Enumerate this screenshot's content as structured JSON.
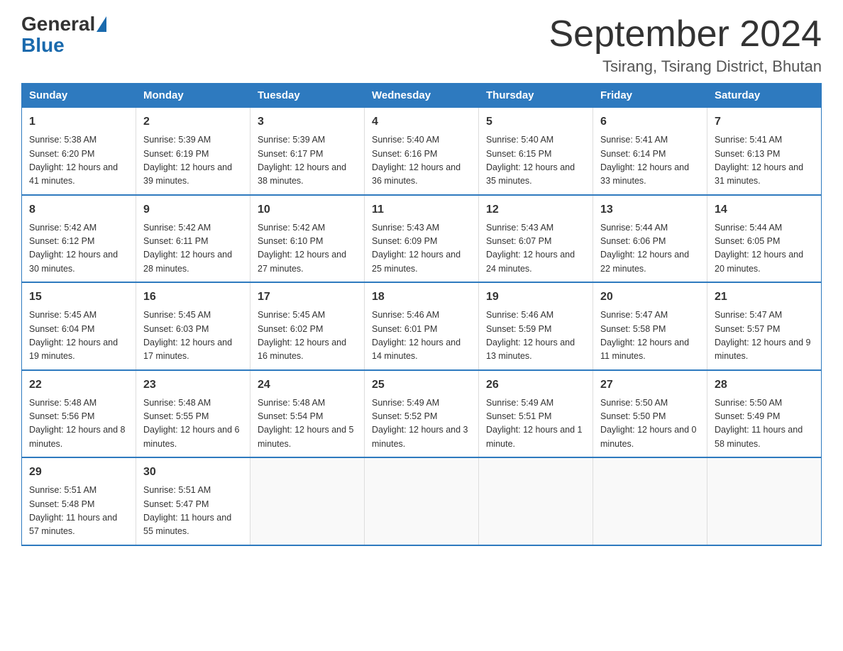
{
  "header": {
    "logo_general": "General",
    "logo_blue": "Blue",
    "title": "September 2024",
    "subtitle": "Tsirang, Tsirang District, Bhutan"
  },
  "days_of_week": [
    "Sunday",
    "Monday",
    "Tuesday",
    "Wednesday",
    "Thursday",
    "Friday",
    "Saturday"
  ],
  "weeks": [
    [
      {
        "day": "1",
        "sunrise": "Sunrise: 5:38 AM",
        "sunset": "Sunset: 6:20 PM",
        "daylight": "Daylight: 12 hours and 41 minutes."
      },
      {
        "day": "2",
        "sunrise": "Sunrise: 5:39 AM",
        "sunset": "Sunset: 6:19 PM",
        "daylight": "Daylight: 12 hours and 39 minutes."
      },
      {
        "day": "3",
        "sunrise": "Sunrise: 5:39 AM",
        "sunset": "Sunset: 6:17 PM",
        "daylight": "Daylight: 12 hours and 38 minutes."
      },
      {
        "day": "4",
        "sunrise": "Sunrise: 5:40 AM",
        "sunset": "Sunset: 6:16 PM",
        "daylight": "Daylight: 12 hours and 36 minutes."
      },
      {
        "day": "5",
        "sunrise": "Sunrise: 5:40 AM",
        "sunset": "Sunset: 6:15 PM",
        "daylight": "Daylight: 12 hours and 35 minutes."
      },
      {
        "day": "6",
        "sunrise": "Sunrise: 5:41 AM",
        "sunset": "Sunset: 6:14 PM",
        "daylight": "Daylight: 12 hours and 33 minutes."
      },
      {
        "day": "7",
        "sunrise": "Sunrise: 5:41 AM",
        "sunset": "Sunset: 6:13 PM",
        "daylight": "Daylight: 12 hours and 31 minutes."
      }
    ],
    [
      {
        "day": "8",
        "sunrise": "Sunrise: 5:42 AM",
        "sunset": "Sunset: 6:12 PM",
        "daylight": "Daylight: 12 hours and 30 minutes."
      },
      {
        "day": "9",
        "sunrise": "Sunrise: 5:42 AM",
        "sunset": "Sunset: 6:11 PM",
        "daylight": "Daylight: 12 hours and 28 minutes."
      },
      {
        "day": "10",
        "sunrise": "Sunrise: 5:42 AM",
        "sunset": "Sunset: 6:10 PM",
        "daylight": "Daylight: 12 hours and 27 minutes."
      },
      {
        "day": "11",
        "sunrise": "Sunrise: 5:43 AM",
        "sunset": "Sunset: 6:09 PM",
        "daylight": "Daylight: 12 hours and 25 minutes."
      },
      {
        "day": "12",
        "sunrise": "Sunrise: 5:43 AM",
        "sunset": "Sunset: 6:07 PM",
        "daylight": "Daylight: 12 hours and 24 minutes."
      },
      {
        "day": "13",
        "sunrise": "Sunrise: 5:44 AM",
        "sunset": "Sunset: 6:06 PM",
        "daylight": "Daylight: 12 hours and 22 minutes."
      },
      {
        "day": "14",
        "sunrise": "Sunrise: 5:44 AM",
        "sunset": "Sunset: 6:05 PM",
        "daylight": "Daylight: 12 hours and 20 minutes."
      }
    ],
    [
      {
        "day": "15",
        "sunrise": "Sunrise: 5:45 AM",
        "sunset": "Sunset: 6:04 PM",
        "daylight": "Daylight: 12 hours and 19 minutes."
      },
      {
        "day": "16",
        "sunrise": "Sunrise: 5:45 AM",
        "sunset": "Sunset: 6:03 PM",
        "daylight": "Daylight: 12 hours and 17 minutes."
      },
      {
        "day": "17",
        "sunrise": "Sunrise: 5:45 AM",
        "sunset": "Sunset: 6:02 PM",
        "daylight": "Daylight: 12 hours and 16 minutes."
      },
      {
        "day": "18",
        "sunrise": "Sunrise: 5:46 AM",
        "sunset": "Sunset: 6:01 PM",
        "daylight": "Daylight: 12 hours and 14 minutes."
      },
      {
        "day": "19",
        "sunrise": "Sunrise: 5:46 AM",
        "sunset": "Sunset: 5:59 PM",
        "daylight": "Daylight: 12 hours and 13 minutes."
      },
      {
        "day": "20",
        "sunrise": "Sunrise: 5:47 AM",
        "sunset": "Sunset: 5:58 PM",
        "daylight": "Daylight: 12 hours and 11 minutes."
      },
      {
        "day": "21",
        "sunrise": "Sunrise: 5:47 AM",
        "sunset": "Sunset: 5:57 PM",
        "daylight": "Daylight: 12 hours and 9 minutes."
      }
    ],
    [
      {
        "day": "22",
        "sunrise": "Sunrise: 5:48 AM",
        "sunset": "Sunset: 5:56 PM",
        "daylight": "Daylight: 12 hours and 8 minutes."
      },
      {
        "day": "23",
        "sunrise": "Sunrise: 5:48 AM",
        "sunset": "Sunset: 5:55 PM",
        "daylight": "Daylight: 12 hours and 6 minutes."
      },
      {
        "day": "24",
        "sunrise": "Sunrise: 5:48 AM",
        "sunset": "Sunset: 5:54 PM",
        "daylight": "Daylight: 12 hours and 5 minutes."
      },
      {
        "day": "25",
        "sunrise": "Sunrise: 5:49 AM",
        "sunset": "Sunset: 5:52 PM",
        "daylight": "Daylight: 12 hours and 3 minutes."
      },
      {
        "day": "26",
        "sunrise": "Sunrise: 5:49 AM",
        "sunset": "Sunset: 5:51 PM",
        "daylight": "Daylight: 12 hours and 1 minute."
      },
      {
        "day": "27",
        "sunrise": "Sunrise: 5:50 AM",
        "sunset": "Sunset: 5:50 PM",
        "daylight": "Daylight: 12 hours and 0 minutes."
      },
      {
        "day": "28",
        "sunrise": "Sunrise: 5:50 AM",
        "sunset": "Sunset: 5:49 PM",
        "daylight": "Daylight: 11 hours and 58 minutes."
      }
    ],
    [
      {
        "day": "29",
        "sunrise": "Sunrise: 5:51 AM",
        "sunset": "Sunset: 5:48 PM",
        "daylight": "Daylight: 11 hours and 57 minutes."
      },
      {
        "day": "30",
        "sunrise": "Sunrise: 5:51 AM",
        "sunset": "Sunset: 5:47 PM",
        "daylight": "Daylight: 11 hours and 55 minutes."
      },
      null,
      null,
      null,
      null,
      null
    ]
  ]
}
